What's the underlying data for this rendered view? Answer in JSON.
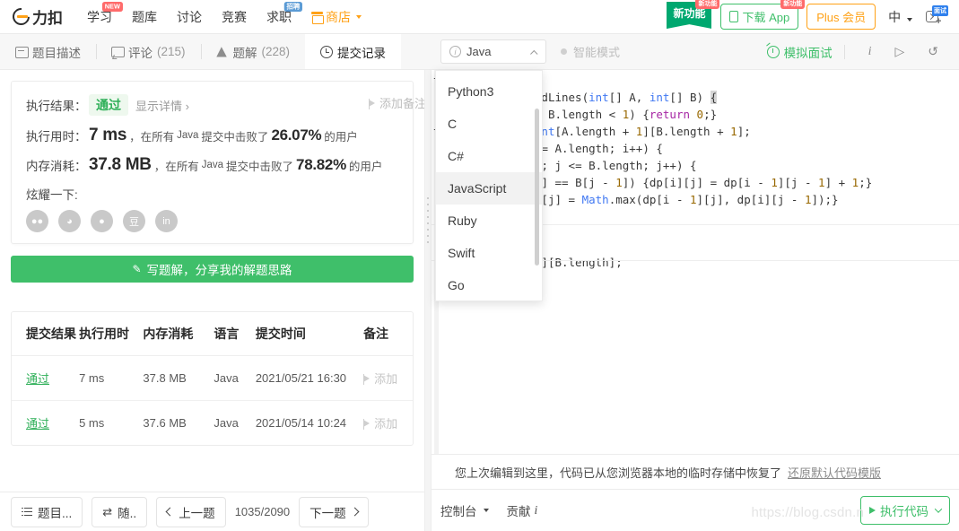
{
  "topnav": {
    "logo_text": "力扣",
    "items": [
      {
        "label": "学习",
        "badge": "NEW",
        "badge_type": "new"
      },
      {
        "label": "题库",
        "badge": "",
        "badge_type": ""
      },
      {
        "label": "讨论",
        "badge": "",
        "badge_type": ""
      },
      {
        "label": "竞赛",
        "badge": "",
        "badge_type": ""
      },
      {
        "label": "求职",
        "badge": "招聘",
        "badge_type": "zp"
      }
    ],
    "shop_label": "商店",
    "ribbon_label": "新功能",
    "ribbon_badge": "新功能",
    "download_app": "下载 App",
    "download_badge": "新功能",
    "plus_member": "Plus 会员",
    "lang_switch": "中",
    "user_badge": "面试"
  },
  "tabs": [
    {
      "label": "题目描述",
      "count": "",
      "icon": "description-icon",
      "active": false
    },
    {
      "label": "评论",
      "count": "(215)",
      "icon": "comment-icon",
      "active": false
    },
    {
      "label": "题解",
      "count": "(228)",
      "icon": "flask-icon",
      "active": false
    },
    {
      "label": "提交记录",
      "count": "",
      "icon": "clock-icon",
      "active": true
    }
  ],
  "result": {
    "exec_result_label": "执行结果：",
    "status": "通过",
    "show_detail": "显示详情 ›",
    "add_note": "添加备注",
    "runtime_label": "执行用时：",
    "runtime_value": "7 ms",
    "runtime_text_a": "，在所有",
    "runtime_lang": "Java",
    "runtime_text_b": "提交中击败了",
    "runtime_pct": "26.07%",
    "runtime_text_c": "的用户",
    "memory_label": "内存消耗：",
    "memory_value": "37.8 MB",
    "memory_pct": "78.82%",
    "share_label": "炫耀一下:",
    "share_icons": [
      "wechat-icon",
      "weibo-icon",
      "qq-icon",
      "douban-icon",
      "linkedin-icon"
    ],
    "write_solution": "写题解，分享我的解题思路"
  },
  "submissions": {
    "headers": [
      "提交结果",
      "执行用时",
      "内存消耗",
      "语言",
      "提交时间",
      "备注"
    ],
    "rows": [
      {
        "status": "通过",
        "runtime": "7 ms",
        "memory": "37.8 MB",
        "lang": "Java",
        "time": "2021/05/21 16:30",
        "note": "添加"
      },
      {
        "status": "通过",
        "runtime": "5 ms",
        "memory": "37.6 MB",
        "lang": "Java",
        "time": "2021/05/14 10:24",
        "note": "添加"
      }
    ]
  },
  "bottombar": {
    "problem_list": "题目...",
    "random": "随..",
    "prev": "上一题",
    "page_count": "1035/2090",
    "next": "下一题"
  },
  "editor": {
    "language": "Java",
    "smart_mode": "智能模式",
    "mock_interview": "模拟面试",
    "dropdown_options": [
      "Python3",
      "C",
      "C#",
      "JavaScript",
      "Ruby",
      "Swift",
      "Go"
    ],
    "dropdown_highlighted": "JavaScript",
    "code_lines": [
      "tion {",
      "  int maxUncrossedLines(int[] A, int[] B) {",
      "(A.length < 1 || B.length < 1) {return 0;}",
      "t[][] dp = new int[A.length + 1][B.length + 1];",
      "r(int i = 1; i <= A.length; i++) {",
      "    for(int j = 1; j <= B.length; j++) {",
      "        if(A[i - 1] == B[j - 1]) {dp[i][j] = dp[i - 1][j - 1] + 1;}",
      "        else{dp[i][j] = Math.max(dp[i - 1][j], dp[i][j - 1]);}",
      "    }",
      ""
    ],
    "code_last_line": "turn dp[A.length][B.length];",
    "restore_message": "您上次编辑到这里，代码已从您浏览器本地的临时存储中恢复了",
    "restore_link": "还原默认代码模版",
    "console": "控制台",
    "contribute": "贡献",
    "run_code": "执行代码",
    "watermark": "https://blog.csdn.n"
  },
  "colors": {
    "brand_orange": "#ffa116",
    "green": "#3fbf6a",
    "pass_green": "#2eaf58",
    "ribbon_green": "#00a870",
    "badge_red": "#ff6b6b",
    "blue": "#2f80ed"
  }
}
